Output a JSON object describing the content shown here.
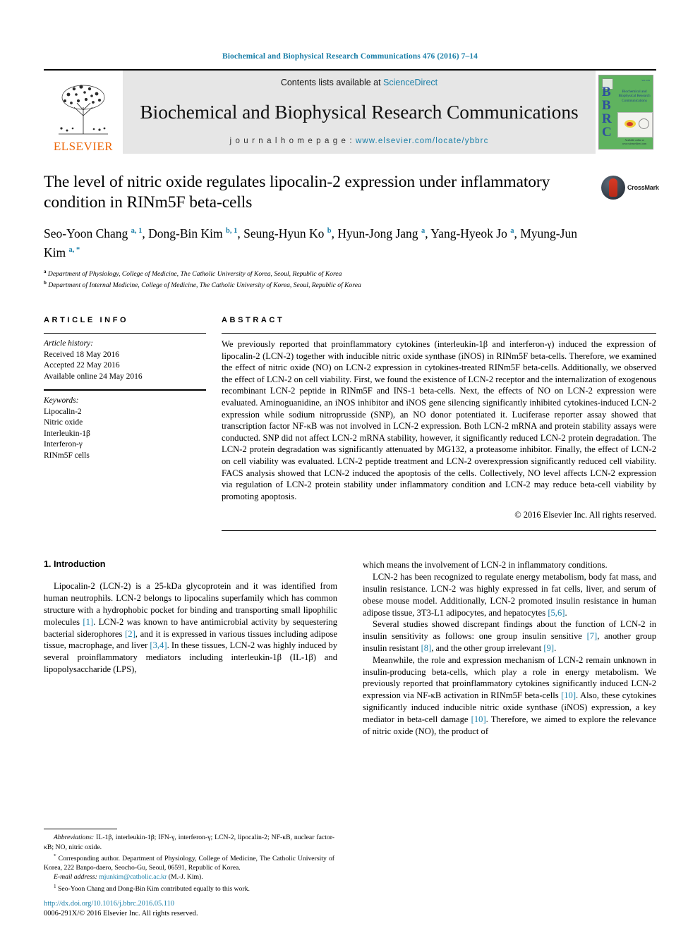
{
  "running_head": "Biochemical and Biophysical Research Communications 476 (2016) 7–14",
  "masthead": {
    "contents_prefix": "Contents lists available at ",
    "sciencedirect": "ScienceDirect",
    "journal_title": "Biochemical and Biophysical Research Communications",
    "homepage_prefix": "j o u r n a l   h o m e p a g e :  ",
    "homepage_url": "www.elsevier.com/locate/ybbrc",
    "publisher": "ELSEVIER",
    "cover": {
      "letters": "BBRC",
      "title": "Biochemical and Biophysical Research Communications",
      "footer": "Available online at www.sciencedirect.com"
    },
    "accent_color": "#1b7fa8",
    "cover_color": "#5fb35f"
  },
  "article": {
    "title": "The level of nitric oxide regulates lipocalin-2 expression under inflammatory condition in RINm5F beta-cells",
    "crossmark_label": "CrossMark",
    "authors_line1": "Seo-Yoon Chang",
    "authors_html": "Seo-Yoon Chang <sup>a, 1</sup>, Dong-Bin Kim <sup>b, 1</sup>, Seung-Hyun Ko <sup>b</sup>, Hyun-Jong Jang <sup>a</sup>, Yang-Hyeok Jo <sup>a</sup>, Myung-Jun Kim <sup>a, *</sup>",
    "affiliation_a": "Department of Physiology, College of Medicine, The Catholic University of Korea, Seoul, Republic of Korea",
    "affiliation_b": "Department of Internal Medicine, College of Medicine, The Catholic University of Korea, Seoul, Republic of Korea"
  },
  "article_info": {
    "heading": "ARTICLE INFO",
    "history_label": "Article history:",
    "history": [
      "Received 18 May 2016",
      "Accepted 22 May 2016",
      "Available online 24 May 2016"
    ],
    "keywords_label": "Keywords:",
    "keywords": [
      "Lipocalin-2",
      "Nitric oxide",
      "Interleukin-1β",
      "Interferon-γ",
      "RINm5F cells"
    ]
  },
  "abstract": {
    "heading": "ABSTRACT",
    "text": "We previously reported that proinflammatory cytokines (interleukin-1β and interferon-γ) induced the expression of lipocalin-2 (LCN-2) together with inducible nitric oxide synthase (iNOS) in RINm5F beta-cells. Therefore, we examined the effect of nitric oxide (NO) on LCN-2 expression in cytokines-treated RINm5F beta-cells. Additionally, we observed the effect of LCN-2 on cell viability. First, we found the existence of LCN-2 receptor and the internalization of exogenous recombinant LCN-2 peptide in RINm5F and INS-1 beta-cells. Next, the effects of NO on LCN-2 expression were evaluated. Aminoguanidine, an iNOS inhibitor and iNOS gene silencing significantly inhibited cytokines-induced LCN-2 expression while sodium nitroprusside (SNP), an NO donor potentiated it. Luciferase reporter assay showed that transcription factor NF-κB was not involved in LCN-2 expression. Both LCN-2 mRNA and protein stability assays were conducted. SNP did not affect LCN-2 mRNA stability, however, it significantly reduced LCN-2 protein degradation. The LCN-2 protein degradation was significantly attenuated by MG132, a proteasome inhibitor. Finally, the effect of LCN-2 on cell viability was evaluated. LCN-2 peptide treatment and LCN-2 overexpression significantly reduced cell viability. FACS analysis showed that LCN-2 induced the apoptosis of the cells. Collectively, NO level affects LCN-2 expression via regulation of LCN-2 protein stability under inflammatory condition and LCN-2 may reduce beta-cell viability by promoting apoptosis.",
    "copyright": "© 2016 Elsevier Inc. All rights reserved."
  },
  "body": {
    "section_heading": "1. Introduction",
    "left_paragraphs": [
      "Lipocalin-2 (LCN-2) is a 25-kDa glycoprotein and it was identified from human neutrophils. LCN-2 belongs to lipocalins superfamily which has common structure with a hydrophobic pocket for binding and transporting small lipophilic molecules [1]. LCN-2 was known to have antimicrobial activity by sequestering bacterial siderophores [2], and it is expressed in various tissues including adipose tissue, macrophage, and liver [3,4]. In these tissues, LCN-2 was highly induced by several proinflammatory mediators including interleukin-1β (IL-1β) and lipopolysaccharide (LPS),"
    ],
    "right_paragraphs": [
      "which means the involvement of LCN-2 in inflammatory conditions.",
      "LCN-2 has been recognized to regulate energy metabolism, body fat mass, and insulin resistance. LCN-2 was highly expressed in fat cells, liver, and serum of obese mouse model. Additionally, LCN-2 promoted insulin resistance in human adipose tissue, 3T3-L1 adipocytes, and hepatocytes [5,6].",
      "Several studies showed discrepant findings about the function of LCN-2 in insulin sensitivity as follows: one group insulin sensitive [7], another group insulin resistant [8], and the other group irrelevant [9].",
      "Meanwhile, the role and expression mechanism of LCN-2 remain unknown in insulin-producing beta-cells, which play a role in energy metabolism. We previously reported that proinflammatory cytokines significantly induced LCN-2 expression via NF-κB activation in RINm5F beta-cells [10]. Also, these cytokines significantly induced inducible nitric oxide synthase (iNOS) expression, a key mediator in beta-cell damage [10]. Therefore, we aimed to explore the relevance of nitric oxide (NO), the product of"
    ]
  },
  "footnotes": {
    "abbreviations_label": "Abbreviations:",
    "abbreviations_text": " IL-1β, interleukin-1β; IFN-γ, interferon-γ; LCN-2, lipocalin-2; NF-κB, nuclear factor-κB; NO, nitric oxide.",
    "corresponding_marker": "*",
    "corresponding_text": " Corresponding author. Department of Physiology, College of Medicine, The Catholic University of Korea, 222 Banpo-daero, Seocho-Gu, Seoul, 06591, Republic of Korea.",
    "email_label": "E-mail address:",
    "email": "mjunkim@catholic.ac.kr",
    "email_suffix": " (M.-J. Kim).",
    "equal_contrib_marker": "1",
    "equal_contrib_text": " Seo-Yoon Chang and Dong-Bin Kim contributed equally to this work."
  },
  "doi_block": {
    "doi": "http://dx.doi.org/10.1016/j.bbrc.2016.05.110",
    "issn_line": "0006-291X/© 2016 Elsevier Inc. All rights reserved."
  }
}
